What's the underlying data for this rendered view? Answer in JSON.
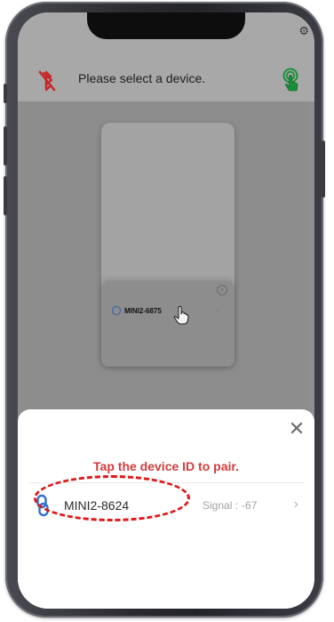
{
  "header": {
    "title": "Please select a device."
  },
  "hint_card": {
    "device_id": "MINI2-6875"
  },
  "sheet": {
    "title": "Tap the device ID to pair.",
    "close_label": "✕",
    "devices": [
      {
        "name": "MINI2-8624",
        "signal_label": "Signal :",
        "signal_value": "-67",
        "arrow": "›"
      }
    ]
  },
  "colors": {
    "sheet_title": "#d23b3b",
    "highlight": "#e01818",
    "bt_off_icon": "#c62828",
    "touch_icon": "#1b8f3a",
    "link_icon": "#2f6fd0"
  },
  "icons": [
    "bluetooth-off-icon",
    "touch-icon",
    "gear-icon",
    "close-icon",
    "link-icon",
    "chevron-right-icon",
    "hand-pointer-icon"
  ]
}
